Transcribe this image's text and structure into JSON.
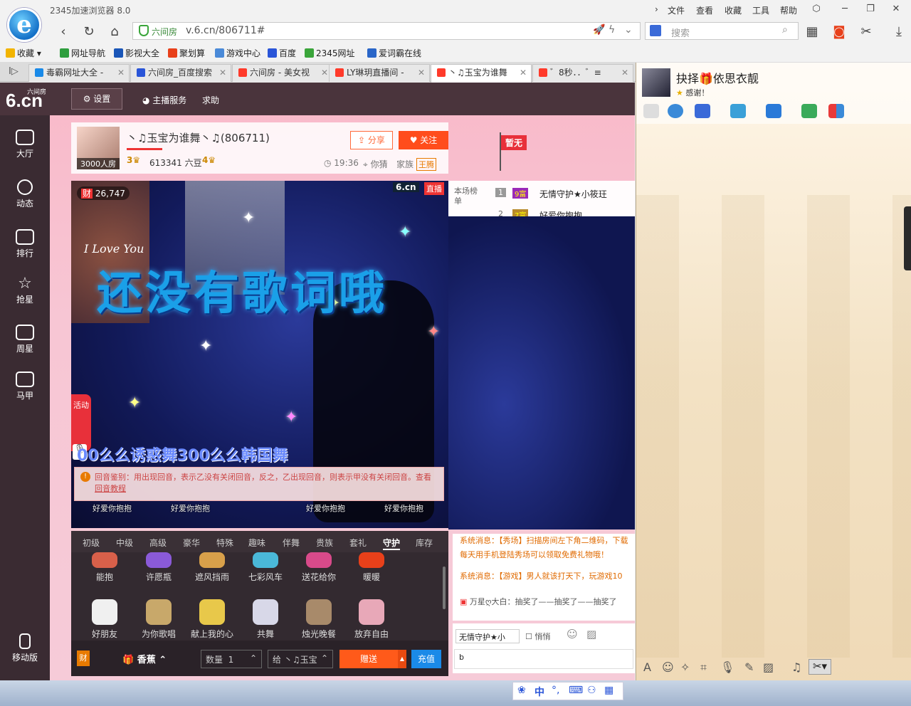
{
  "browser": {
    "title": "2345加速浏览器 8.0",
    "menus": [
      "文件",
      "查看",
      "收藏",
      "工具",
      "帮助"
    ],
    "url_site_label": "六间房",
    "url": "v.6.cn/806711#",
    "search_placeholder": "搜索"
  },
  "bookmarks": [
    {
      "label": "收藏",
      "color": "#f2b400"
    },
    {
      "label": "网址导航",
      "color": "#2e9e3e"
    },
    {
      "label": "影视大全",
      "color": "#1a56b8"
    },
    {
      "label": "聚划算",
      "color": "#e8401a"
    },
    {
      "label": "游戏中心",
      "color": "#4a8ad8"
    },
    {
      "label": "百度",
      "color": "#2a55d8"
    },
    {
      "label": "2345网址",
      "color": "#3aa53a"
    },
    {
      "label": "爱词霸在线",
      "color": "#2a66c8"
    }
  ],
  "tabs": [
    {
      "label": "毒霸网址大全 -",
      "color": "#1a8ae8"
    },
    {
      "label": "六间房_百度搜索",
      "color": "#2a55d8"
    },
    {
      "label": "六间房 - 美女视",
      "color": "#ff3a2a"
    },
    {
      "label": "LY琳玥直播间 -",
      "color": "#ff3a2a"
    },
    {
      "label": "丶♫玉宝为谁舞",
      "color": "#ff3a2a"
    },
    {
      "label": "゛8秒．．゛≡",
      "color": "#ff3a2a"
    }
  ],
  "site": {
    "logo_top": "六间房",
    "logo_main": "6.cn",
    "settings": "设置",
    "anchor_service": "主播服务",
    "help": "求助",
    "left_nav": [
      "大厅",
      "动态",
      "排行",
      "抢星",
      "周星",
      "马甲",
      "移动版"
    ]
  },
  "room": {
    "badge": "3000人房",
    "title": "丶♫玉宝为谁舞丶♫(806711)",
    "level": "3",
    "beans": "613341 六豆",
    "level2": "4",
    "time": "19:36",
    "state": "你猜",
    "family_label": "家族",
    "family": "王腾",
    "share": "分享",
    "follow": "关注",
    "flag": "暂无"
  },
  "video": {
    "wealth": "26,747",
    "brand": "6.cn",
    "live": "直播",
    "lyrics": "还没有歌词哦",
    "song_marquee": "00么么诱惑舞300么么韩国舞",
    "activity": "活动",
    "love_text": "I Love You"
  },
  "rank": {
    "label": "本场榜单",
    "items": [
      {
        "rank": "1",
        "badge": "9富",
        "name": "无情守护★小筱玨"
      },
      {
        "rank": "2",
        "badge": "7富",
        "name": "好爱你抱抱"
      }
    ]
  },
  "notice": {
    "text": "回音鉴别：用出现回音，表示乙没有关闭回音，反之，乙出现回音，则表示甲没有关闭回音。查看",
    "link": "回音教程"
  },
  "seats": [
    "好爱你抱抱",
    "好爱你抱抱",
    "好爱你抱抱",
    "好爱你抱抱"
  ],
  "gift_tabs": [
    "初级",
    "中级",
    "高级",
    "豪华",
    "特殊",
    "趣味",
    "伴舞",
    "贵族",
    "套礼",
    "守护",
    "库存"
  ],
  "active_gift_tab": "守护",
  "gifts_row1": [
    {
      "label": "能抱",
      "color": "#d8604a"
    },
    {
      "label": "许愿瓶",
      "color": "#8a5ad8"
    },
    {
      "label": "遮风挡雨",
      "color": "#d8a04a"
    },
    {
      "label": "七彩风车",
      "color": "#4ab8d8"
    },
    {
      "label": "送花给你",
      "color": "#d84a8a"
    },
    {
      "label": "暖暖",
      "color": "#e8401a"
    }
  ],
  "gifts_row2": [
    {
      "label": "好朋友",
      "color": "#f0f0f0"
    },
    {
      "label": "为你歌唱",
      "color": "#c8a86a"
    },
    {
      "label": "献上我的心",
      "color": "#e8c84a"
    },
    {
      "label": "共舞",
      "color": "#d8d8e8"
    },
    {
      "label": "烛光晚餐",
      "color": "#a88a6a"
    },
    {
      "label": "放弃自由",
      "color": "#e8a8b8"
    }
  ],
  "sendbar": {
    "gift_name": "香蕉",
    "qty_label": "数量",
    "qty": "1",
    "to_label": "给",
    "to_name": "丶♫玉宝",
    "send": "赠送",
    "charge": "充值"
  },
  "chat": {
    "messages": [
      "系统消息：【秀场】扫描房间左下角二维码，下载",
      "每天用手机登陆秀场可以领取免费礼物哦！",
      "系统消息：【游戏】男人就该打天下，玩游戏10",
      "万星ღ大白：抽奖了——抽奖了——抽奖了"
    ],
    "target": "无情守护★小",
    "whisper": "悄悄",
    "input_value": "b"
  },
  "qq": {
    "name": "抉择🎁依思衣靓",
    "status": "感谢！",
    "tool_icons": [
      "microphone-icon",
      "camera-icon",
      "screen-share-icon",
      "file-transfer-icon",
      "remote-desktop-icon",
      "add-app-icon",
      "app-grid-icon"
    ]
  }
}
